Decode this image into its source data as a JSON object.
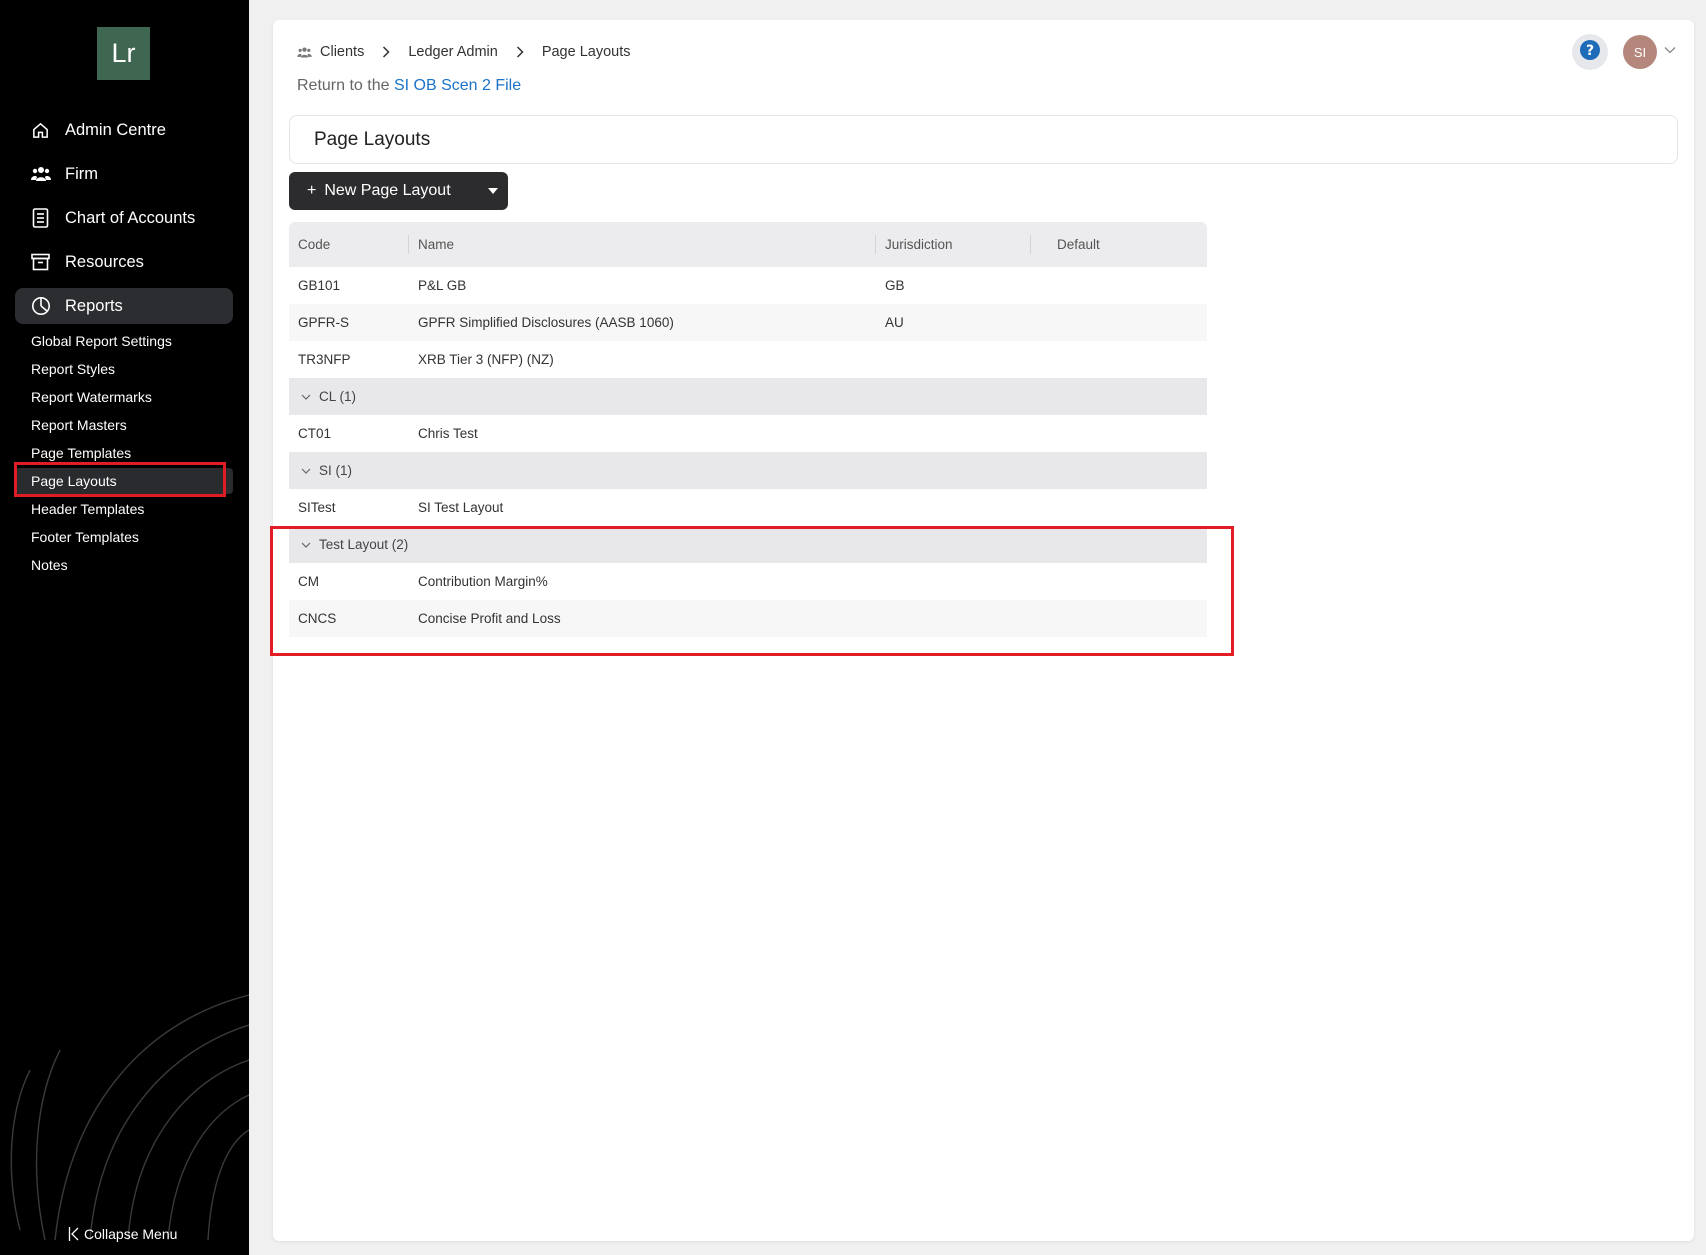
{
  "sidebar": {
    "logo": "Lr",
    "nav": [
      {
        "label": "Admin Centre",
        "icon": "home-icon"
      },
      {
        "label": "Firm",
        "icon": "users-icon"
      },
      {
        "label": "Chart of Accounts",
        "icon": "ledger-icon"
      },
      {
        "label": "Resources",
        "icon": "archive-icon"
      },
      {
        "label": "Reports",
        "icon": "pie-chart-icon"
      }
    ],
    "report_items": [
      "Global Report Settings",
      "Report Styles",
      "Report Watermarks",
      "Report Masters",
      "Page Templates",
      "Page Layouts",
      "Header Templates",
      "Footer Templates",
      "Notes"
    ],
    "active_item": "Page Layouts",
    "collapse_label": "Collapse Menu"
  },
  "header": {
    "breadcrumb": [
      "Clients",
      "Ledger Admin",
      "Page Layouts"
    ],
    "return_prefix": "Return to the",
    "return_link": "SI OB Scen 2 File",
    "avatar_initials": "SI"
  },
  "page": {
    "title": "Page Layouts",
    "new_button": "New Page Layout"
  },
  "table": {
    "columns": [
      "Code",
      "Name",
      "Jurisdiction",
      "Default"
    ],
    "rows": [
      {
        "code": "GB101",
        "name": "P&L GB",
        "jurisdiction": "GB"
      },
      {
        "code": "GPFR-S",
        "name": "GPFR Simplified Disclosures (AASB 1060)",
        "jurisdiction": "AU"
      },
      {
        "code": "TR3NFP",
        "name": "XRB Tier 3 (NFP) (NZ)",
        "jurisdiction": ""
      }
    ],
    "groups": [
      {
        "label": "CL (1)",
        "rows": [
          {
            "code": "CT01",
            "name": "Chris Test"
          }
        ]
      },
      {
        "label": "SI (1)",
        "rows": [
          {
            "code": "SITest",
            "name": "SI Test Layout"
          }
        ]
      },
      {
        "label": "Test Layout (2)",
        "rows": [
          {
            "code": "CM",
            "name": "Contribution Margin%"
          },
          {
            "code": "CNCS",
            "name": "Concise Profit and Loss"
          }
        ]
      }
    ]
  },
  "colors": {
    "highlight": "#e11c24",
    "link": "#1a73c9",
    "logo_bg": "#3e6651",
    "button_bg": "#2c2c2e"
  }
}
